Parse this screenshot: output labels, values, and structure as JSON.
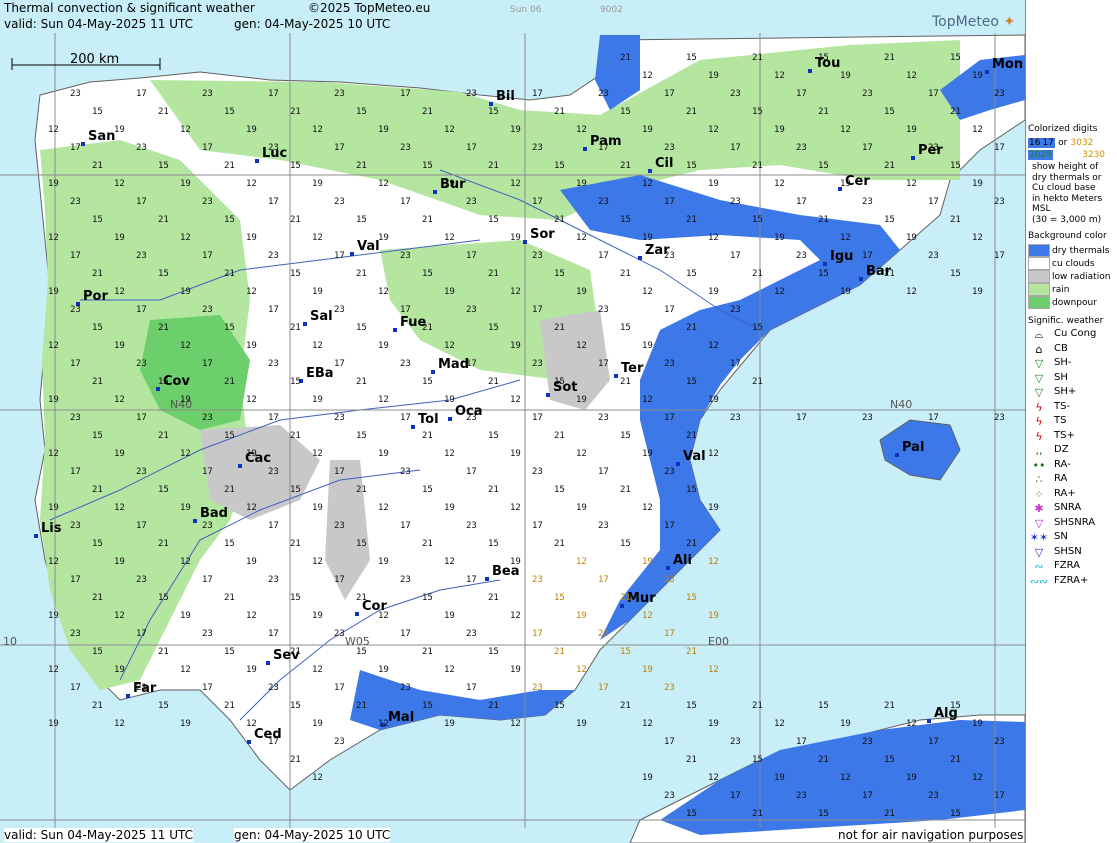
{
  "header": {
    "title": "Thermal convection & significant weather",
    "copyright": "©2025 TopMeteo.eu",
    "day_tab": "Sun 06",
    "code": "9002",
    "valid": "valid:  Sun  04-May-2025  11 UTC",
    "gen": "gen: 04-May-2025 10 UTC"
  },
  "footer": {
    "valid": "valid:  Sun  04-May-2025  11 UTC",
    "gen": "gen: 04-May-2025 10 UTC",
    "disclaimer": "not for air navigation purposes"
  },
  "logo": "TopMeteo",
  "scale_label": "200 km",
  "grid_labels": [
    "N40",
    "N40",
    "E00",
    "W05",
    "10"
  ],
  "cities": [
    {
      "name": "San"
    },
    {
      "name": "Luc"
    },
    {
      "name": "Bil"
    },
    {
      "name": "Pam"
    },
    {
      "name": "Tou"
    },
    {
      "name": "Mon"
    },
    {
      "name": "Per"
    },
    {
      "name": "Cil"
    },
    {
      "name": "Cer"
    },
    {
      "name": "Bur"
    },
    {
      "name": "Sor"
    },
    {
      "name": "Zar"
    },
    {
      "name": "Igu"
    },
    {
      "name": "Bar"
    },
    {
      "name": "Val"
    },
    {
      "name": "Por"
    },
    {
      "name": "Sal"
    },
    {
      "name": "Fue"
    },
    {
      "name": "Mad"
    },
    {
      "name": "Cov"
    },
    {
      "name": "EBa"
    },
    {
      "name": "Sot"
    },
    {
      "name": "Ter"
    },
    {
      "name": "Tol"
    },
    {
      "name": "Oca"
    },
    {
      "name": "Pal"
    },
    {
      "name": "Cac"
    },
    {
      "name": "Val"
    },
    {
      "name": "Lis"
    },
    {
      "name": "Bad"
    },
    {
      "name": "Bea"
    },
    {
      "name": "Ali"
    },
    {
      "name": "Cor"
    },
    {
      "name": "Mur"
    },
    {
      "name": "Sev"
    },
    {
      "name": "Far"
    },
    {
      "name": "Mal"
    },
    {
      "name": "Ced"
    },
    {
      "name": "Alg"
    }
  ],
  "legend": {
    "colorized_title": "Colorized digits",
    "digit_samples": {
      "a": "16",
      "b": "17",
      "c": "3032",
      "or": "or",
      "d": "2025",
      "e": "3230"
    },
    "colorized_desc": [
      "show height of",
      "dry thermals or",
      "Cu cloud base",
      "in hekto Meters",
      "MSL",
      "(30 = 3,000 m)"
    ],
    "bg_title": "Background color",
    "bg_items": [
      {
        "label": "dry thermals",
        "color": "#3c78e8"
      },
      {
        "label": "cu clouds",
        "color": "#ffffff"
      },
      {
        "label": "low radiation",
        "color": "#c8c8c8"
      },
      {
        "label": "rain",
        "color": "#b4e6a0"
      },
      {
        "label": "downpour",
        "color": "#6ccf6c"
      }
    ],
    "wx_title": "Signific. weather",
    "wx_items": [
      {
        "label": "Cu Cong",
        "icon": "cu-cong-icon",
        "color": "#000000"
      },
      {
        "label": "CB",
        "icon": "cb-icon",
        "color": "#000000"
      },
      {
        "label": "SH-",
        "icon": "shower-light-icon",
        "color": "#1a8a1a"
      },
      {
        "label": "SH",
        "icon": "shower-icon",
        "color": "#1a8a1a"
      },
      {
        "label": "SH+",
        "icon": "shower-heavy-icon",
        "color": "#1a8a1a"
      },
      {
        "label": "TS-",
        "icon": "thunder-light-icon",
        "color": "#cc0000"
      },
      {
        "label": "TS",
        "icon": "thunder-icon",
        "color": "#cc0000"
      },
      {
        "label": "TS+",
        "icon": "thunder-heavy-icon",
        "color": "#cc0000"
      },
      {
        "label": "DZ",
        "icon": "drizzle-icon",
        "color": "#1a6a1a"
      },
      {
        "label": "RA-",
        "icon": "rain-light-icon",
        "color": "#1a6a1a"
      },
      {
        "label": "RA",
        "icon": "rain-icon",
        "color": "#1a6a1a"
      },
      {
        "label": "RA+",
        "icon": "rain-heavy-icon",
        "color": "#1a6a1a"
      },
      {
        "label": "SNRA",
        "icon": "snow-rain-icon",
        "color": "#cc33cc"
      },
      {
        "label": "SHSNRA",
        "icon": "snow-rain-shower-icon",
        "color": "#cc33cc"
      },
      {
        "label": "SN",
        "icon": "snow-icon",
        "color": "#2233cc"
      },
      {
        "label": "SHSN",
        "icon": "snow-shower-icon",
        "color": "#2233cc"
      },
      {
        "label": "FZRA",
        "icon": "freezing-rain-icon",
        "color": "#22bbdd"
      },
      {
        "label": "FZRA+",
        "icon": "freezing-rain-heavy-icon",
        "color": "#22bbdd"
      }
    ]
  },
  "colors": {
    "sea": "#c8eef8",
    "land": "#ffffff",
    "dry": "#3c78e8",
    "low_radiation": "#c8c8c8",
    "rain": "#b4e6a0",
    "downpour": "#6ccf6c",
    "gridline": "#8c8c8c",
    "river": "#4060c0",
    "border": "#606060"
  }
}
